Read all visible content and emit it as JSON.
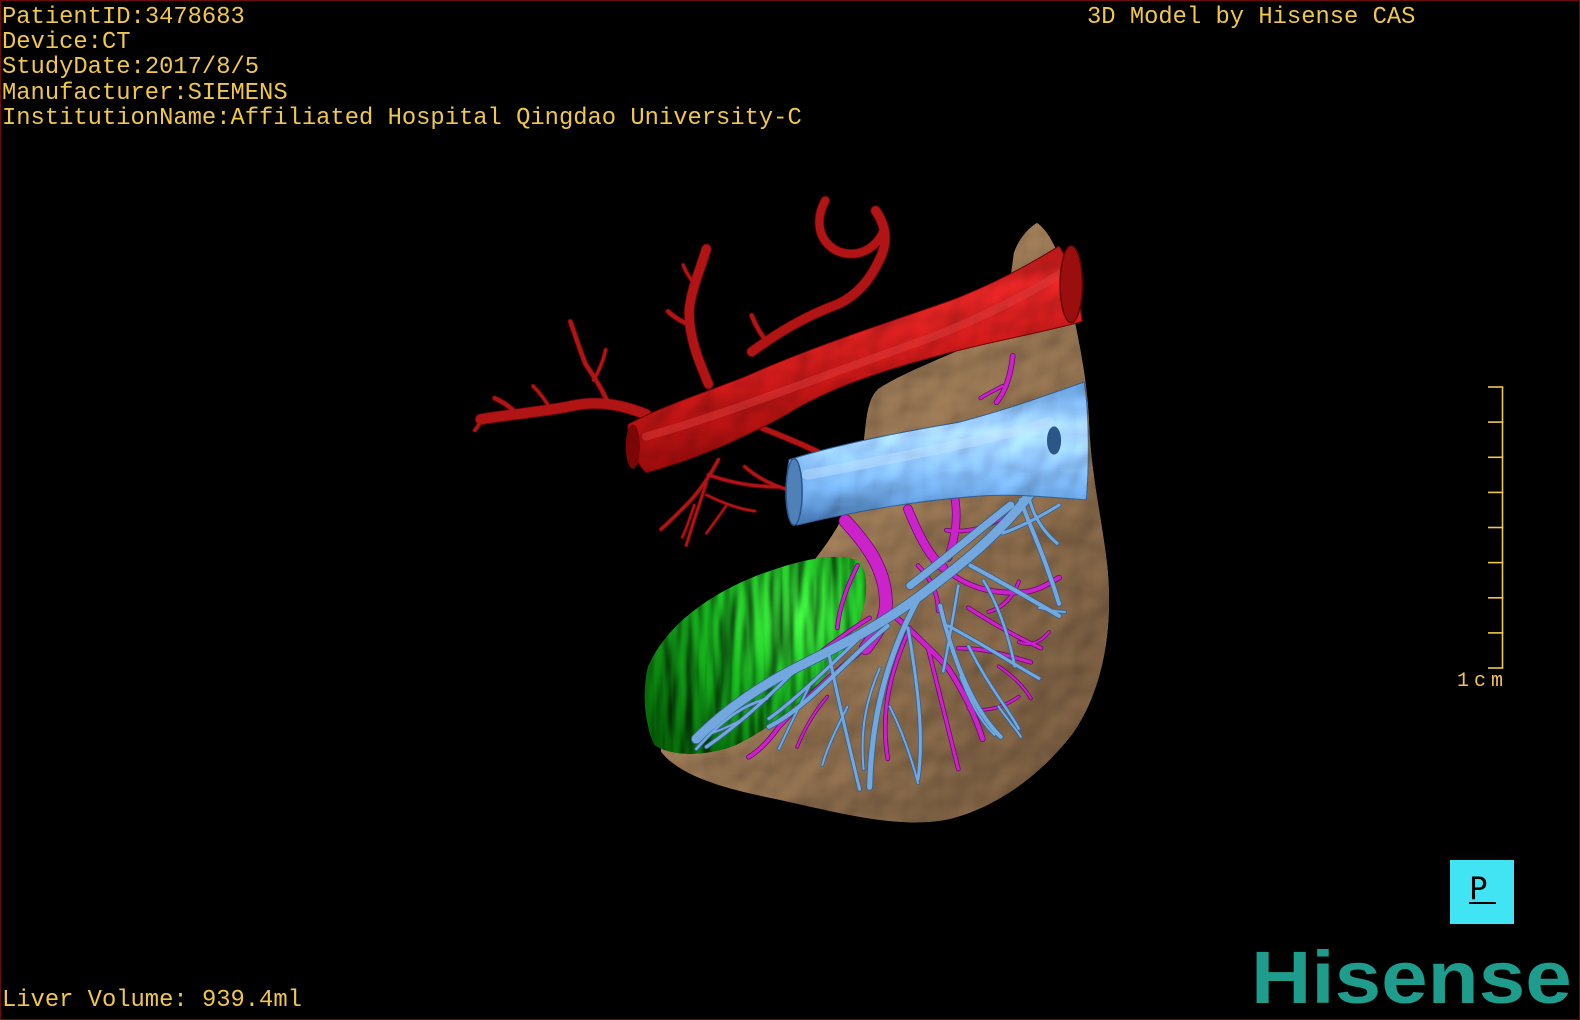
{
  "overlay": {
    "patient_id": {
      "label": "PatientID:",
      "value": "3478683"
    },
    "device": {
      "label": "Device:",
      "value": "CT"
    },
    "study_date": {
      "label": "StudyDate:",
      "value": "2017/8/5"
    },
    "manufacturer": {
      "label": "Manufacturer:",
      "value": "SIEMENS"
    },
    "institution": {
      "label": "InstitutionName:",
      "value": "Affiliated Hospital Qingdao University-C"
    },
    "model_credit": "3D Model by Hisense CAS",
    "liver_volume": {
      "label": "Liver Volume:",
      "value": "939.4ml"
    }
  },
  "scale_bar": {
    "label": "1cm"
  },
  "orientation_cube": {
    "label": "P",
    "icon": "orientation-cube-icon"
  },
  "logo": {
    "text": "Hisense"
  },
  "colors": {
    "overlay_text": "#efc84a",
    "frame_border": "#6a0c0c",
    "background": "#000000",
    "orientation_box": "#40e4f2",
    "logo": "#1e9c8c",
    "liver": "#7a5f40",
    "artery": "#b01414",
    "vena_cava": "#78aee4",
    "hepatic_vein": "#72a8de",
    "portal_vein": "#cc22cc",
    "tumor": "#129412"
  }
}
